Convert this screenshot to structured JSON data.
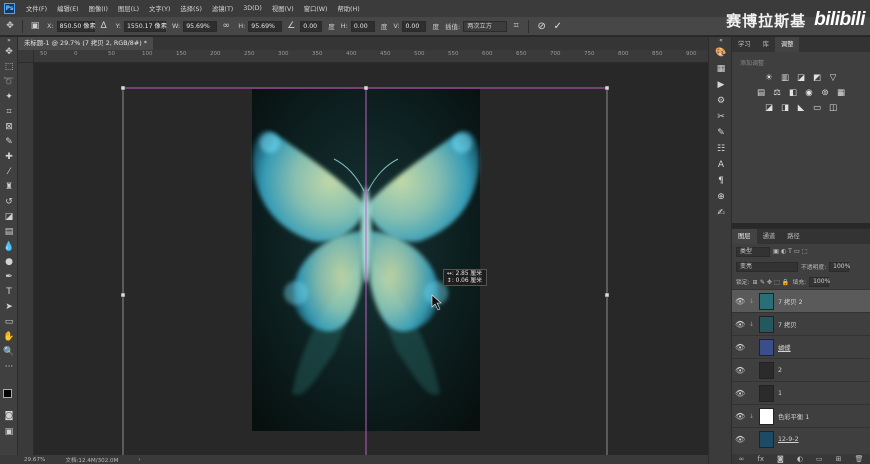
{
  "menubar": {
    "app_icon": "Ps",
    "items": [
      "文件(F)",
      "编辑(E)",
      "图像(I)",
      "图层(L)",
      "文字(Y)",
      "选择(S)",
      "滤镜(T)",
      "3D(D)",
      "视图(V)",
      "窗口(W)",
      "帮助(H)"
    ]
  },
  "brand": {
    "text": "赛博拉斯基",
    "logo": "bilibili"
  },
  "options": {
    "x_label": "X:",
    "x_value": "850.50 像素",
    "y_label": "Y:",
    "y_value": "1550.17 像素",
    "w_label": "W:",
    "w_value": "95.69%",
    "h_label": "H:",
    "h_value": "95.69%",
    "angle_value": "0.00",
    "angle_unit": "度",
    "hskew_label": "H:",
    "hskew_value": "0.00",
    "hskew_unit": "度",
    "vskew_label": "V:",
    "vskew_value": "0.00",
    "vskew_unit": "度",
    "interp_label": "插值:",
    "interp_value": "两次立方"
  },
  "document": {
    "tab_title": "未标题-1 @ 29.7% (7 拷贝 2, RGB/8#) *",
    "ruler_ticks": [
      "50",
      "0",
      "50",
      "100",
      "150",
      "200",
      "250",
      "300",
      "350",
      "400",
      "450",
      "500",
      "550",
      "600",
      "650",
      "700",
      "750",
      "800",
      "850",
      "900"
    ]
  },
  "canvas": {
    "tooltip_w": "↔: 2.85 厘米",
    "tooltip_h": "↕: 0.06 厘米"
  },
  "status": {
    "zoom": "29.67%",
    "doc": "文档:12.4M/302.0M"
  },
  "panels": {
    "adjust_tabs": [
      "学习",
      "库",
      "调整"
    ],
    "adjust_active": "调整",
    "adjust_hint": "添加调整",
    "layers_tabs": [
      "图层",
      "通道",
      "路径"
    ],
    "layers_active": "图层",
    "filter_kind": "类型",
    "blend_mode": "变亮",
    "opacity_label": "不透明度:",
    "opacity_value": "100%",
    "lock_label": "锁定:",
    "fill_label": "填充:",
    "fill_value": "100%",
    "layers": [
      {
        "name": "7 拷贝 2",
        "selected": true,
        "thumb_color": "#2a6f77"
      },
      {
        "name": "7 拷贝",
        "selected": false,
        "thumb_color": "#23585f"
      },
      {
        "name": "蝴蝶",
        "selected": false,
        "thumb_color": "#3a4f8a"
      },
      {
        "name": "2",
        "selected": false,
        "thumb_color": "#2b2b2b"
      },
      {
        "name": "1",
        "selected": false,
        "thumb_color": "#2b2b2b"
      },
      {
        "name": "色彩平衡 1",
        "selected": false,
        "thumb_color": "#ffffff"
      },
      {
        "name": "12-9-2",
        "selected": false,
        "thumb_color": "#1d4b66"
      }
    ]
  },
  "colors": {
    "accent_guide": "#c45ac8",
    "butterfly_glow": "#7fe7ff",
    "butterfly_core": "#d9ffb0",
    "image_bg": "#0c1d20"
  }
}
